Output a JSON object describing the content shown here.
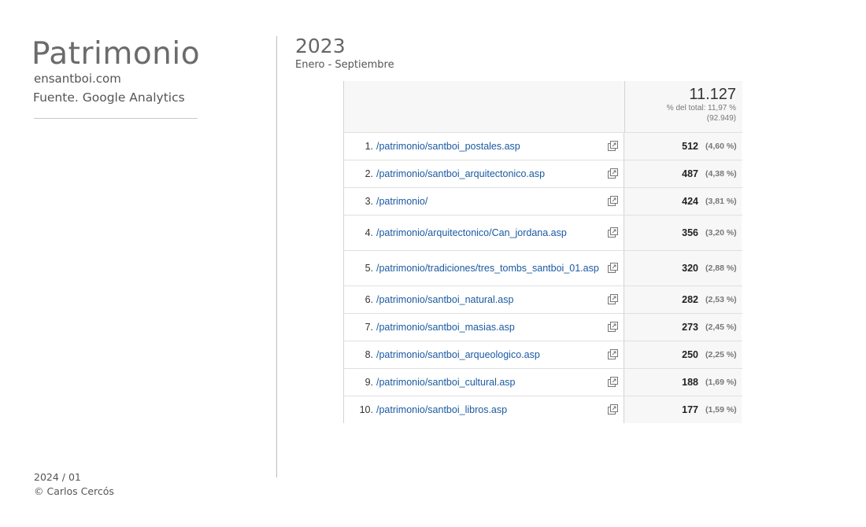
{
  "header": {
    "title": "Patrimonio",
    "site": "ensantboi.com",
    "source": "Fuente. Google Analytics"
  },
  "footer": {
    "date": "2024 / 01",
    "copyright": "© Carlos Cercós"
  },
  "report": {
    "year": "2023",
    "period": "Enero - Septiembre",
    "total": "11.127",
    "total_pct": "% del total: 11,97 %",
    "total_base": "(92.949)",
    "rows": [
      {
        "rank": "1.",
        "url": "/patrimonio/santboi_postales.asp",
        "value": "512",
        "pct": "(4,60 %)"
      },
      {
        "rank": "2.",
        "url": "/patrimonio/santboi_arquitectonico.asp",
        "value": "487",
        "pct": "(4,38 %)"
      },
      {
        "rank": "3.",
        "url": "/patrimonio/",
        "value": "424",
        "pct": "(3,81 %)"
      },
      {
        "rank": "4.",
        "url": "/patrimonio/arquitectonico/Can_jordana.asp",
        "value": "356",
        "pct": "(3,20 %)"
      },
      {
        "rank": "5.",
        "url": "/patrimonio/tradiciones/tres_tombs_santboi_01.asp",
        "value": "320",
        "pct": "(2,88 %)"
      },
      {
        "rank": "6.",
        "url": "/patrimonio/santboi_natural.asp",
        "value": "282",
        "pct": "(2,53 %)"
      },
      {
        "rank": "7.",
        "url": "/patrimonio/santboi_masias.asp",
        "value": "273",
        "pct": "(2,45 %)"
      },
      {
        "rank": "8.",
        "url": "/patrimonio/santboi_arqueologico.asp",
        "value": "250",
        "pct": "(2,25 %)"
      },
      {
        "rank": "9.",
        "url": "/patrimonio/santboi_cultural.asp",
        "value": "188",
        "pct": "(1,69 %)"
      },
      {
        "rank": "10.",
        "url": "/patrimonio/santboi_libros.asp",
        "value": "177",
        "pct": "(1,59 %)"
      }
    ]
  },
  "icons": {
    "row_link": "external-link-icon"
  },
  "colors": {
    "link": "#1b5aa1",
    "header_bg": "#f7f7f7",
    "divider": "#bdbdbd"
  }
}
